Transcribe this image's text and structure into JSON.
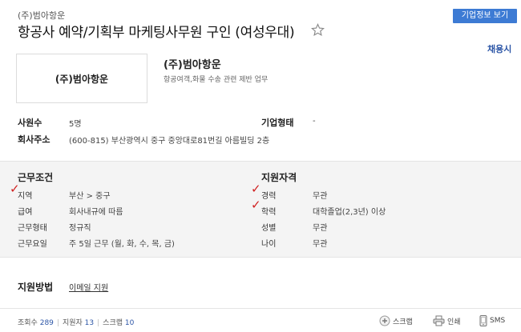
{
  "header": {
    "company_small": "(주)범아항운",
    "company_info_button": "기업정보 보기",
    "job_title": "항공사 예약/기획부 마케팅사무원 구인 (여성우대)",
    "recruit_type": "채용시"
  },
  "company": {
    "logo_text": "(주)범아항운",
    "name": "(주)범아항운",
    "description": "항공여객,화물 수송 관련 제반 업무"
  },
  "details": {
    "employees_label": "사원수",
    "employees_value": "5명",
    "company_type_label": "기업형태",
    "company_type_value": "-",
    "address_label": "회사주소",
    "address_value": "(600-815) 부산광역시 중구 중앙대로81번길 아름빌딩 2층"
  },
  "conditions": {
    "heading": "근무조건",
    "rows": [
      {
        "label": "지역",
        "value": "부산 > 중구"
      },
      {
        "label": "급여",
        "value": "회사내규에 따름"
      },
      {
        "label": "근무형태",
        "value": "정규직"
      },
      {
        "label": "근무요일",
        "value": "주 5일 근무 (월, 화, 수, 목, 금)"
      }
    ]
  },
  "qualifications": {
    "heading": "지원자격",
    "rows": [
      {
        "label": "경력",
        "value": "무관"
      },
      {
        "label": "학력",
        "value": "대학졸업(2,3년) 이상"
      },
      {
        "label": "성별",
        "value": "무관"
      },
      {
        "label": "나이",
        "value": "무관"
      }
    ]
  },
  "apply": {
    "label": "지원방법",
    "method": "이메일 지원"
  },
  "stats": {
    "views_label": "조회수",
    "views": "289",
    "applicants_label": "지원자",
    "applicants": "13",
    "scraps_label": "스크랩",
    "scraps": "10"
  },
  "actions": {
    "scrap": "스크랩",
    "print": "인쇄",
    "sms": "SMS"
  },
  "colors": {
    "accent": "#3d7bd4",
    "link": "#2b55a6",
    "check_mark": "#d02020",
    "panel_bg": "#f4f4f4"
  }
}
